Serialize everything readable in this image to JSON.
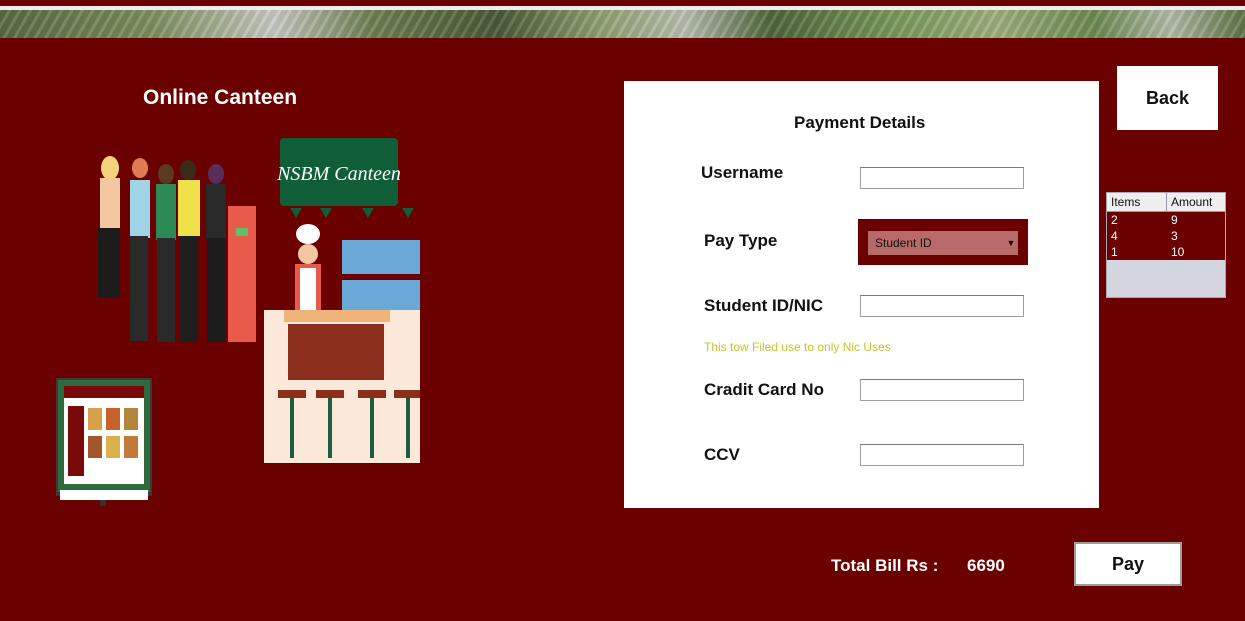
{
  "app_title": "Online Canteen",
  "back_label": "Back",
  "illustration": {
    "sign_text": "NSBM Canteen"
  },
  "payment": {
    "title": "Payment Details",
    "username_label": "Username",
    "username_value": "",
    "pay_type_label": "Pay Type",
    "pay_type_selected": "Student ID",
    "student_id_label": "Student ID/NIC",
    "student_id_value": "",
    "hint": "This tow Filed use to only Nic Uses",
    "card_label": "Cradit Card No",
    "card_value": "",
    "ccv_label": "CCV",
    "ccv_value": ""
  },
  "items_table": {
    "headers": [
      "Items",
      "Amount"
    ],
    "rows": [
      [
        "2",
        "9"
      ],
      [
        "4",
        "3"
      ],
      [
        "1",
        "10"
      ]
    ]
  },
  "total": {
    "label": "Total Bill Rs :",
    "value": "6690"
  },
  "pay_label": "Pay",
  "colors": {
    "background": "#6b0000",
    "panel": "#ffffff",
    "hint": "#c9c22a",
    "select": "#b86a6a"
  }
}
